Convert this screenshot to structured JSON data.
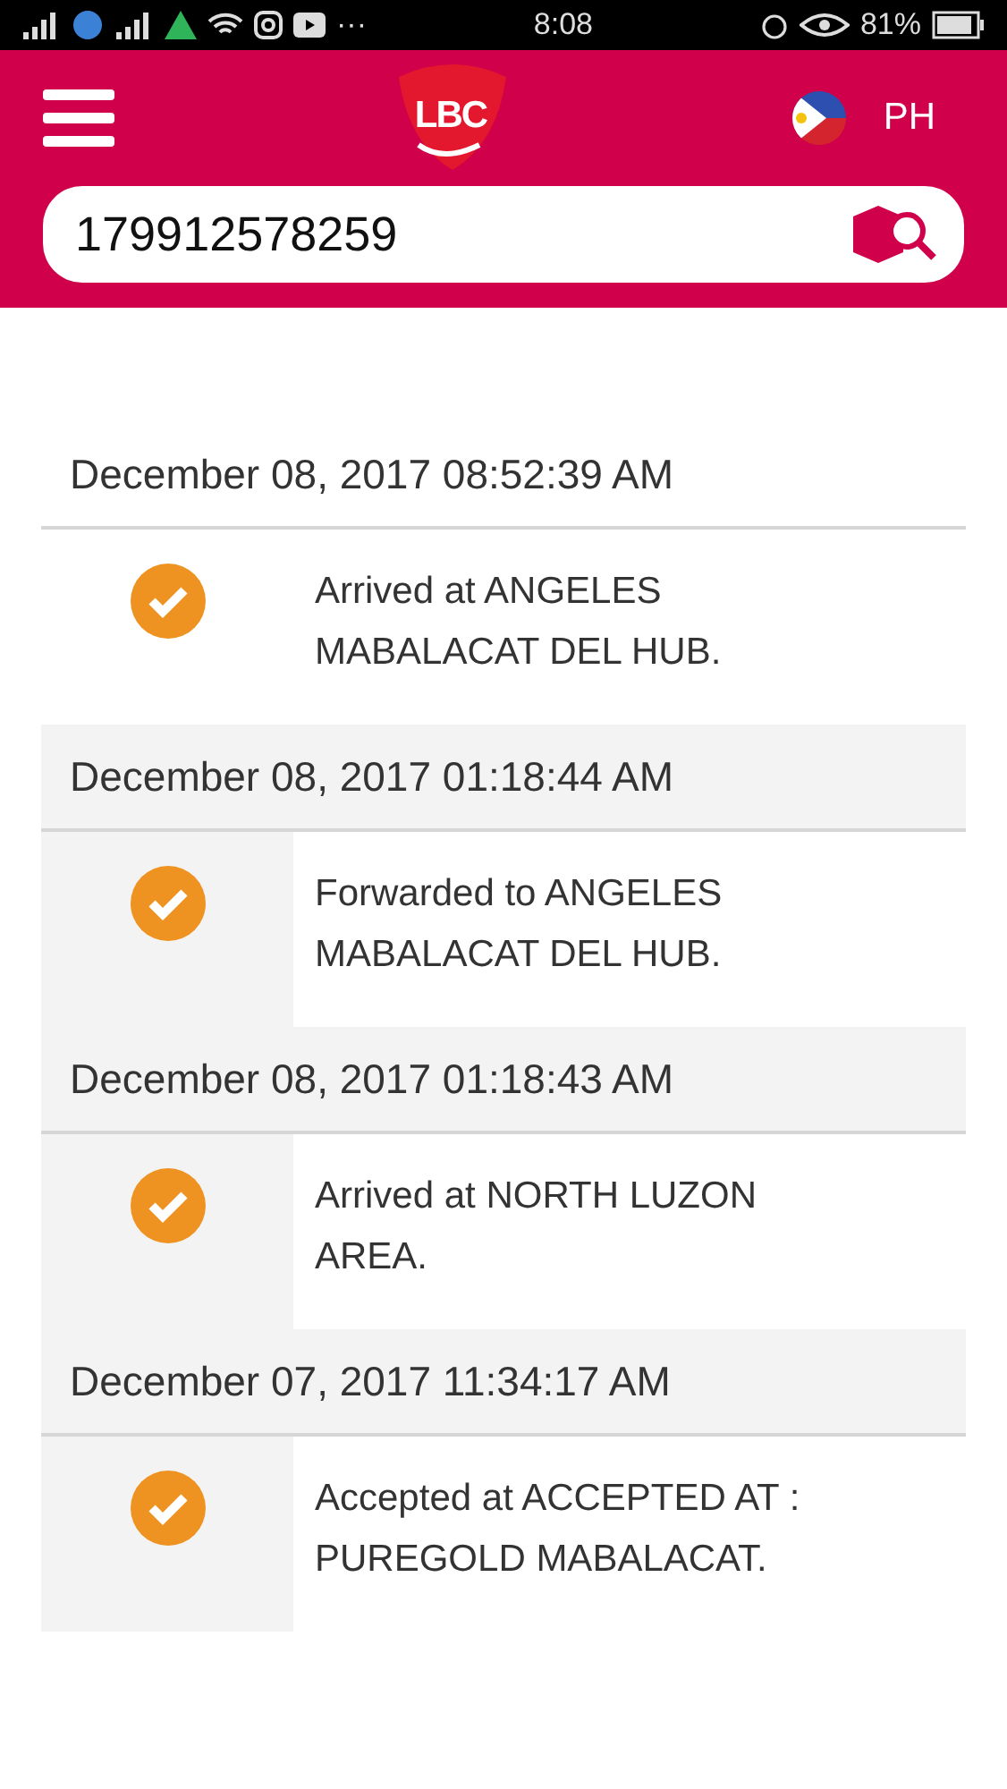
{
  "status_bar": {
    "more": "···",
    "time": "8:08",
    "battery": "81%"
  },
  "header": {
    "logo": "LBC",
    "region": "PH"
  },
  "search": {
    "value": "179912578259"
  },
  "events": [
    {
      "datetime": "December 08, 2017 08:52:39 AM",
      "status": "Arrived at ANGELES MABALACAT DEL HUB.",
      "latest": true
    },
    {
      "datetime": "December 08, 2017 01:18:44 AM",
      "status": "Forwarded to ANGELES MABALACAT DEL HUB.",
      "latest": false
    },
    {
      "datetime": "December 08, 2017 01:18:43 AM",
      "status": "Arrived at NORTH LUZON AREA.",
      "latest": false
    },
    {
      "datetime": "December 07, 2017 11:34:17 AM",
      "status": "Accepted at ACCEPTED AT : PUREGOLD MABALACAT.",
      "latest": false
    }
  ]
}
